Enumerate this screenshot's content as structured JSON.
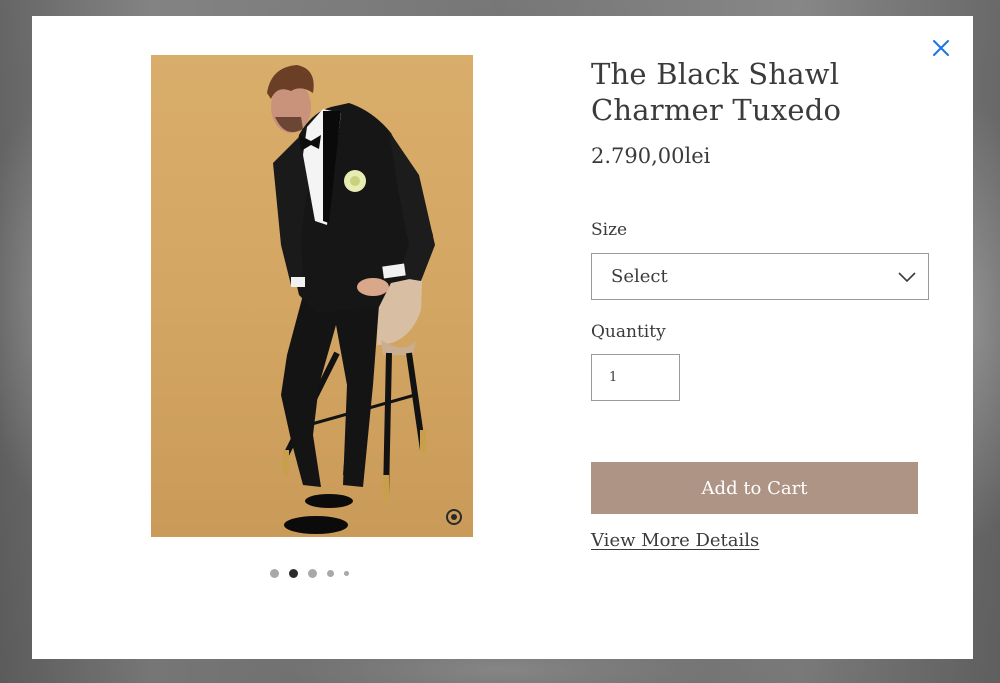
{
  "product": {
    "title_line1": "The Black Shawl",
    "title_line2": "Charmer Tuxedo",
    "price": "2.790,00lei",
    "image_alt": "Model wearing black shawl collar tuxedo"
  },
  "options": {
    "size_label": "Size",
    "size_selected": "Select",
    "quantity_label": "Quantity",
    "quantity_value": "1"
  },
  "actions": {
    "add_to_cart": "Add to Cart",
    "view_more": "View More Details"
  },
  "gallery": {
    "dots_count": 5,
    "active_index": 1
  },
  "icons": {
    "close": "close-icon",
    "dropdown": "chevron-down-icon"
  },
  "colors": {
    "accent_close": "#1a73e8",
    "cart_button": "#ae9484",
    "text": "#3b3b3b",
    "image_bg": "#d4a664"
  }
}
